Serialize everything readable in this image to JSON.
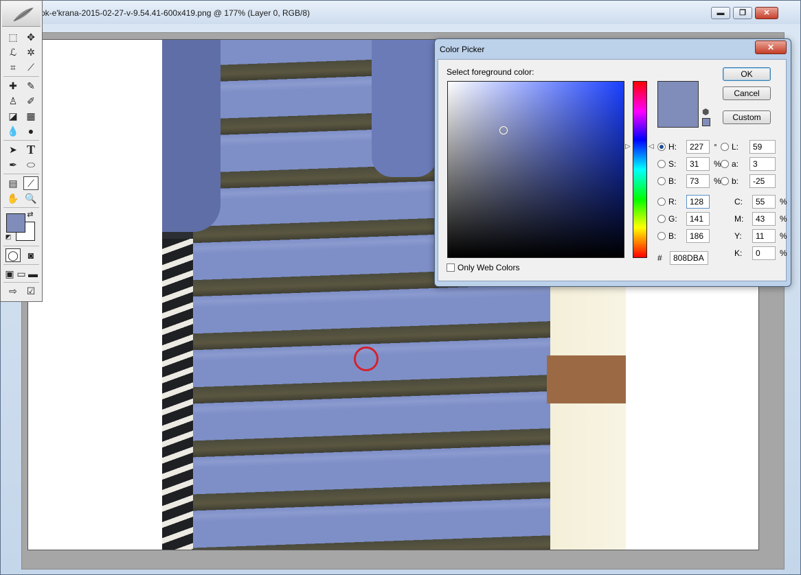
{
  "document": {
    "title": "ok-e'krana-2015-02-27-v-9.54.41-600x419.png @ 177% (Layer 0, RGB/8)",
    "minimize_glyph": "▬",
    "restore_glyph": "❐",
    "close_glyph": "✕"
  },
  "toolbox": {
    "foreground_color": "#808DBA",
    "background_color": "#FFFFFF"
  },
  "color_picker": {
    "title": "Color Picker",
    "close_glyph": "✕",
    "prompt": "Select foreground color:",
    "buttons": {
      "ok": "OK",
      "cancel": "Cancel",
      "custom": "Custom"
    },
    "hsb": {
      "h": {
        "label": "H:",
        "value": "227",
        "unit": "°"
      },
      "s": {
        "label": "S:",
        "value": "31",
        "unit": "%"
      },
      "b": {
        "label": "B:",
        "value": "73",
        "unit": "%"
      }
    },
    "rgb": {
      "r": {
        "label": "R:",
        "value": "128"
      },
      "g": {
        "label": "G:",
        "value": "141"
      },
      "b": {
        "label": "B:",
        "value": "186"
      }
    },
    "lab": {
      "l": {
        "label": "L:",
        "value": "59"
      },
      "a": {
        "label": "a:",
        "value": "3"
      },
      "b": {
        "label": "b:",
        "value": "-25"
      }
    },
    "cmyk": {
      "c": {
        "label": "C:",
        "value": "55",
        "unit": "%"
      },
      "m": {
        "label": "M:",
        "value": "43",
        "unit": "%"
      },
      "y": {
        "label": "Y:",
        "value": "11",
        "unit": "%"
      },
      "k": {
        "label": "K:",
        "value": "0",
        "unit": "%"
      }
    },
    "hex": {
      "label": "#",
      "value": "808DBA"
    },
    "only_web_colors": "Only Web Colors",
    "selected_color": "#808DBA"
  }
}
